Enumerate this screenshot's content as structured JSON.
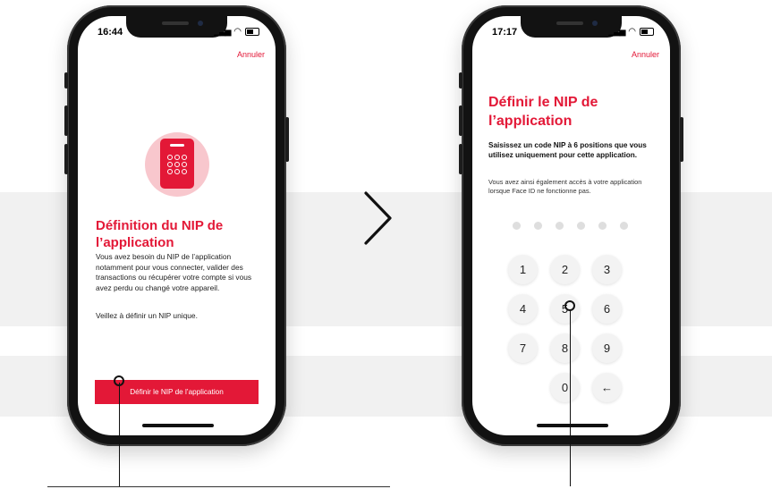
{
  "left_phone": {
    "time": "16:44",
    "cancel_label": "Annuler",
    "title": "Définition du NIP de l’application",
    "body": "Vous avez besoin du NIP de l’application notamment pour vous connecter, valider des transactions ou récupérer votre compte si vous avez perdu ou changé votre appareil.",
    "body2": "Veillez à définir un NIP unique.",
    "cta_label": "Définir le NIP de l’application"
  },
  "right_phone": {
    "time": "17:17",
    "cancel_label": "Annuler",
    "title": "Définir le NIP de l’application",
    "instruction_bold": "Saisissez un code NIP à 6 positions que vous utilisez uniquement pour cette application.",
    "instruction": "Vous avez ainsi également accès à votre application lorsque Face ID ne fonctionne pas.",
    "pin_length": 6,
    "keys": [
      "1",
      "2",
      "3",
      "4",
      "5",
      "6",
      "7",
      "8",
      "9",
      "",
      "0",
      "←"
    ]
  },
  "icons": {
    "arrow": "chevron-right-icon",
    "keypad": "keypad-device-icon",
    "backspace": "arrow-left-icon"
  },
  "colors": {
    "accent": "#e31837",
    "accent_light": "#f8c7cd",
    "frame": "#121212",
    "key_bg": "#f3f3f3",
    "pin_dot": "#dedede"
  }
}
